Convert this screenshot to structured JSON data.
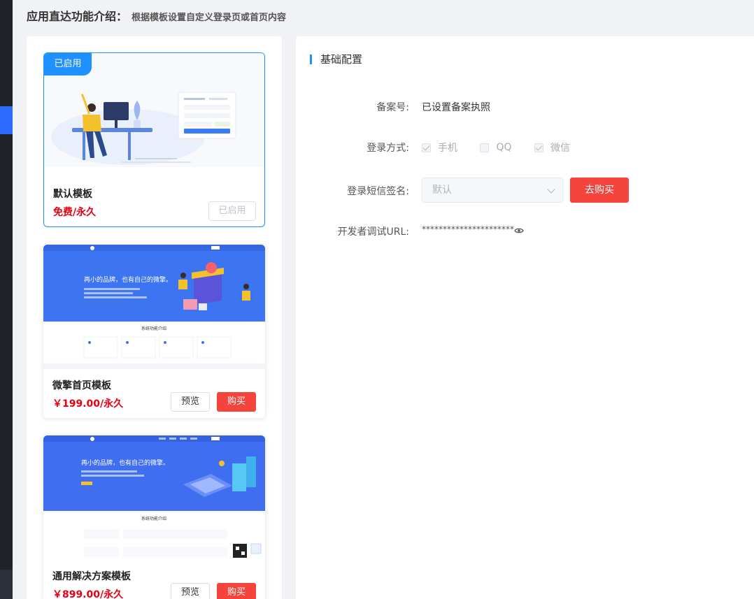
{
  "header": {
    "title": "应用直达功能介绍：",
    "description": "根据模板设置自定义登录页或首页内容"
  },
  "templates": [
    {
      "badge": "已启用",
      "name": "默认模板",
      "price": "免费/永久",
      "action_label": "已启用"
    },
    {
      "name": "微擎首页模板",
      "price": "￥199.00/永久",
      "preview_label": "预览",
      "buy_label": "购买",
      "thumb": {
        "headline": "再小的品牌，也有自己的微擎。",
        "section": "系统功能介绍"
      }
    },
    {
      "name": "通用解决方案模板",
      "price": "￥899.00/永久",
      "preview_label": "预览",
      "buy_label": "购买",
      "thumb": {
        "headline": "再小的品牌，也有自己的微擎。",
        "section": "系统功能介绍"
      }
    }
  ],
  "config": {
    "section_title": "基础配置",
    "record_label": "备案号:",
    "record_value": "已设置备案执照",
    "login_label": "登录方式:",
    "login_options": [
      {
        "label": "手机",
        "checked": true
      },
      {
        "label": "QQ",
        "checked": false
      },
      {
        "label": "微信",
        "checked": true
      }
    ],
    "sms_label": "登录短信签名:",
    "sms_value": "默认",
    "buy_button": "去购买",
    "dev_url_label": "开发者调试URL:",
    "dev_url_value": "**********************"
  },
  "colors": {
    "primary": "#1e90ff",
    "danger": "#f5443b",
    "price": "#e60012"
  }
}
